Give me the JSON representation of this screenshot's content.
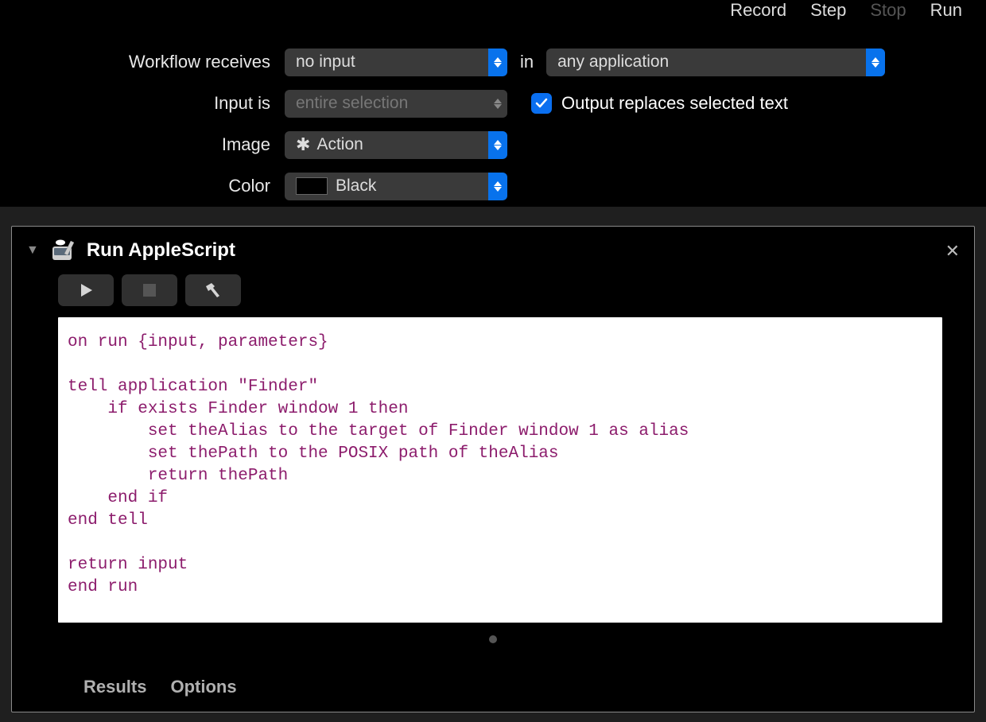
{
  "toolbar": {
    "record": "Record",
    "step": "Step",
    "stop": "Stop",
    "run": "Run"
  },
  "config": {
    "receives_label": "Workflow receives",
    "receives_value": "no input",
    "in_label": "in",
    "app_value": "any application",
    "input_is_label": "Input is",
    "input_is_value": "entire selection",
    "output_replaces_label": "Output replaces selected text",
    "output_replaces_checked": true,
    "image_label": "Image",
    "image_value": "Action",
    "color_label": "Color",
    "color_value": "Black"
  },
  "action": {
    "title": "Run AppleScript",
    "code": "on run {input, parameters}\n\ntell application \"Finder\"\n    if exists Finder window 1 then\n        set theAlias to the target of Finder window 1 as alias\n        set thePath to the POSIX path of theAlias\n        return thePath\n    end if\nend tell\n\nreturn input\nend run",
    "footer": {
      "results": "Results",
      "options": "Options"
    }
  }
}
